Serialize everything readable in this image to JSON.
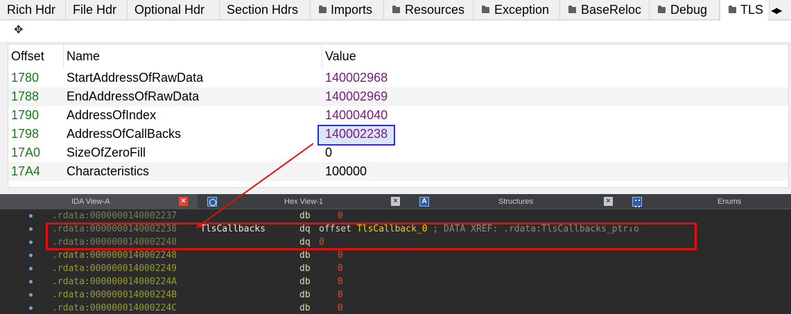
{
  "tabs": [
    {
      "label": "Rich Hdr",
      "folder": false
    },
    {
      "label": "File Hdr",
      "folder": false
    },
    {
      "label": "Optional Hdr",
      "folder": false
    },
    {
      "label": "Section Hdrs",
      "folder": false
    },
    {
      "label": "Imports",
      "folder": true
    },
    {
      "label": "Resources",
      "folder": true
    },
    {
      "label": "Exception",
      "folder": true
    },
    {
      "label": "BaseReloc",
      "folder": true
    },
    {
      "label": "Debug",
      "folder": true
    },
    {
      "label": "TLS",
      "folder": true,
      "active": true
    }
  ],
  "tab_scroll_icon": "left-right-arrows-icon",
  "toolbar_icon": "move-icon",
  "table": {
    "columns": [
      "Offset",
      "Name",
      "Value"
    ],
    "rows": [
      {
        "offset": "1780",
        "name": "StartAddressOfRawData",
        "value": "140002968",
        "color": "#7a1a7a"
      },
      {
        "offset": "1788",
        "name": "EndAddressOfRawData",
        "value": "140002969",
        "color": "#7a1a7a"
      },
      {
        "offset": "1790",
        "name": "AddressOfIndex",
        "value": "140004040",
        "color": "#7a1a7a"
      },
      {
        "offset": "1798",
        "name": "AddressOfCallBacks",
        "value": "140002238",
        "color": "#7a1a7a",
        "selected": true
      },
      {
        "offset": "17A0",
        "name": "SizeOfZeroFill",
        "value": "0",
        "color": "#000000"
      },
      {
        "offset": "17A4",
        "name": "Characteristics",
        "value": "100000",
        "color": "#000000"
      }
    ]
  },
  "ida": {
    "tabs": [
      {
        "label": "IDA View-A",
        "active": true,
        "icon": "ida-view-icon"
      },
      {
        "label": "Hex View-1",
        "active": false,
        "icon": "hex-view-icon"
      },
      {
        "label": "Structures",
        "active": false,
        "icon": "structures-icon"
      },
      {
        "label": "Enums",
        "active": false,
        "icon": "enums-icon"
      }
    ],
    "lines": [
      {
        "addr": ".rdata:0000000140002237",
        "label": "",
        "mnem": "db",
        "operand": "0",
        "kind": "db"
      },
      {
        "addr": ".rdata:0000000140002238",
        "label": "TlsCallbacks",
        "mnem": "dq",
        "kw": "offset",
        "sym": "TlsCallback_0",
        "comment": "; DATA XREF: .rdata:TlsCallbacks_ptr↓o",
        "kind": "ptr"
      },
      {
        "addr": ".rdata:0000000140002240",
        "label": "",
        "mnem": "dq",
        "operand": "0",
        "kind": "dq"
      },
      {
        "addr": ".rdata:0000000140002248",
        "label": "",
        "mnem": "db",
        "operand": "0",
        "kind": "db"
      },
      {
        "addr": ".rdata:0000000140002249",
        "label": "",
        "mnem": "db",
        "operand": "0",
        "kind": "db"
      },
      {
        "addr": ".rdata:000000014000224A",
        "label": "",
        "mnem": "db",
        "operand": "0",
        "kind": "db"
      },
      {
        "addr": ".rdata:000000014000224B",
        "label": "",
        "mnem": "db",
        "operand": "0",
        "kind": "db"
      },
      {
        "addr": ".rdata:000000014000224C",
        "label": "",
        "mnem": "db",
        "operand": "0",
        "kind": "db"
      }
    ]
  },
  "colors": {
    "offset": "#1a7a1a",
    "highlight_box": "#e01010",
    "selection_box": "#2a2ae0"
  }
}
